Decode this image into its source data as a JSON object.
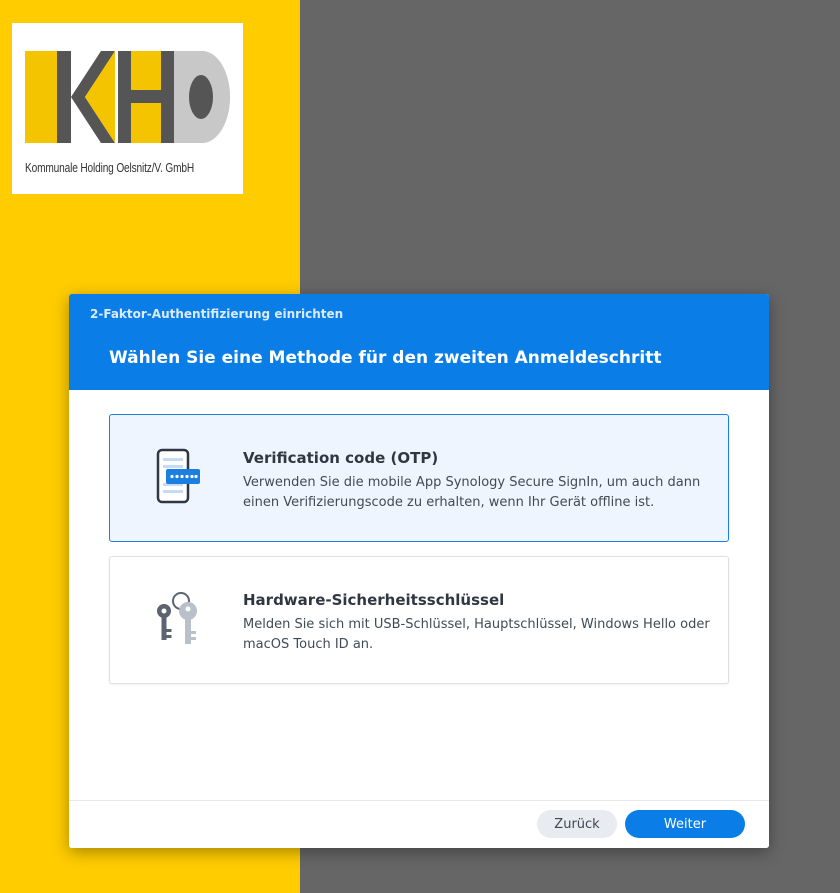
{
  "logo": {
    "caption": "Kommunale Holding Oelsnitz/V. GmbH"
  },
  "dialog": {
    "title": "2-Faktor-Authentifizierung einrichten",
    "heading": "Wählen Sie eine Methode für den zweiten Anmeldeschritt",
    "options": [
      {
        "icon": "phone-otp-icon",
        "title": "Verification code (OTP)",
        "description": "Verwenden Sie die mobile App Synology Secure SignIn, um auch dann einen Verifizierungscode zu erhalten, wenn Ihr Gerät offline ist.",
        "selected": true
      },
      {
        "icon": "keys-icon",
        "title": "Hardware-Sicherheitsschlüssel",
        "description": "Melden Sie sich mit USB-Schlüssel, Hauptschlüssel, Windows Hello oder macOS Touch ID an.",
        "selected": false
      }
    ],
    "buttons": {
      "back": "Zurück",
      "next": "Weiter"
    }
  },
  "colors": {
    "accent": "#0a7ee6",
    "left_background": "#ffcc00",
    "right_background": "#666666",
    "selected_option_background": "#eef5ff"
  }
}
